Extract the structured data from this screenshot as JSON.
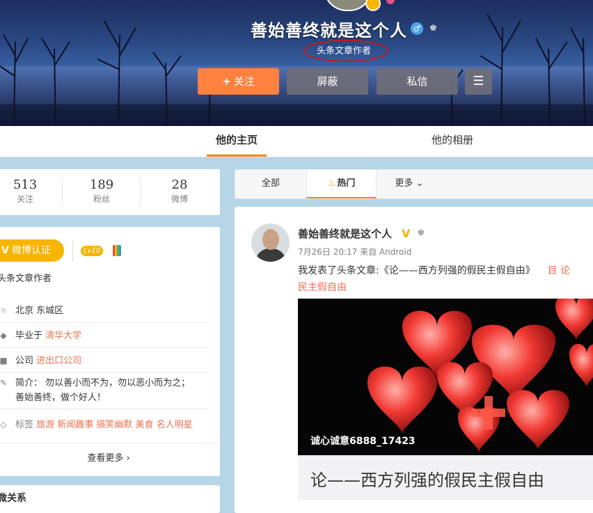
{
  "profile": {
    "name": "善始善终就是这个人",
    "label": "头条文章作者",
    "gender_icon": "♂",
    "robot_icon": "♚"
  },
  "actions": {
    "follow": "关注",
    "follow_plus": "+",
    "block": "屏蔽",
    "message": "私信",
    "menu_icon": "☰"
  },
  "tabs": {
    "home": "他的主页",
    "album": "他的相册"
  },
  "stats": [
    {
      "num": "513",
      "label": "关注"
    },
    {
      "num": "189",
      "label": "粉丝"
    },
    {
      "num": "28",
      "label": "微博"
    }
  ],
  "info": {
    "verify_v": "V",
    "verify_label": "微博认证",
    "level": "Lv10",
    "title": "头条文章作者",
    "location": "北京 东城区",
    "edu_prefix": "毕业于",
    "edu_link": "清华大学",
    "company_prefix": "公司",
    "company_link": "进出口公司",
    "bio_line1": "简介： 勿以善小而不为，勿以恶小而为之；",
    "bio_line2": "善始善终，做个好人！",
    "tags_prefix": "标签",
    "tags": "旅游 新闻趣事 搞笑幽默 美食 名人明星",
    "see_more": "查看更多",
    "see_more_arrow": "›"
  },
  "relations": {
    "title": "微关系"
  },
  "feed_tabs": {
    "all": "全部",
    "hot_icon": "♨",
    "hot": "热门",
    "more": "更多",
    "more_arrow": "⌄"
  },
  "post": {
    "name": "善始善终就是这个人",
    "v": "V",
    "robot": "♚",
    "meta": "7月26日 20:17 来自 Android",
    "text": "我发表了头条文章:《论——西方列强的假民主假自由》",
    "doc_label": "目 论",
    "text_cont": "民主假自由",
    "image_caption": "诚心诚意6888_17423",
    "article_title": "论——西方列强的假民主假自由"
  },
  "colors": {
    "accent": "#ff8200",
    "follow_button": "#ff8140",
    "verify_gold": "#f7b500",
    "link": "#eb7350",
    "annotation_red": "#c81818"
  }
}
